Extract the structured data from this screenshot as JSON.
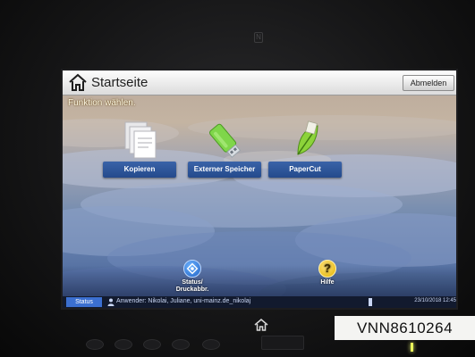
{
  "header": {
    "title": "Startseite",
    "logout_label": "Abmelden"
  },
  "hint": "Funktion wählen.",
  "tiles": [
    {
      "label": "Kopieren",
      "icon": "copy-documents-icon"
    },
    {
      "label": "Externer Speicher",
      "icon": "usb-drive-icon"
    },
    {
      "label": "PaperCut",
      "icon": "papercut-leaf-icon"
    }
  ],
  "dock": {
    "status_label": "Status/\nDruckabbr.",
    "help_label": "Hilfe"
  },
  "statusbar": {
    "status_button": "Status",
    "user_text": "Anwender: Nikolai, Juliane, uni-mainz.de_nikolaj",
    "datetime": "23/10/2018  12:45"
  },
  "device": {
    "serial_label": "VNN8610264"
  },
  "colors": {
    "accent_blue": "#3b6fd0",
    "tile_blue": "#2b538f",
    "help_yellow": "#f0c419",
    "led_green": "#e9f55a"
  }
}
